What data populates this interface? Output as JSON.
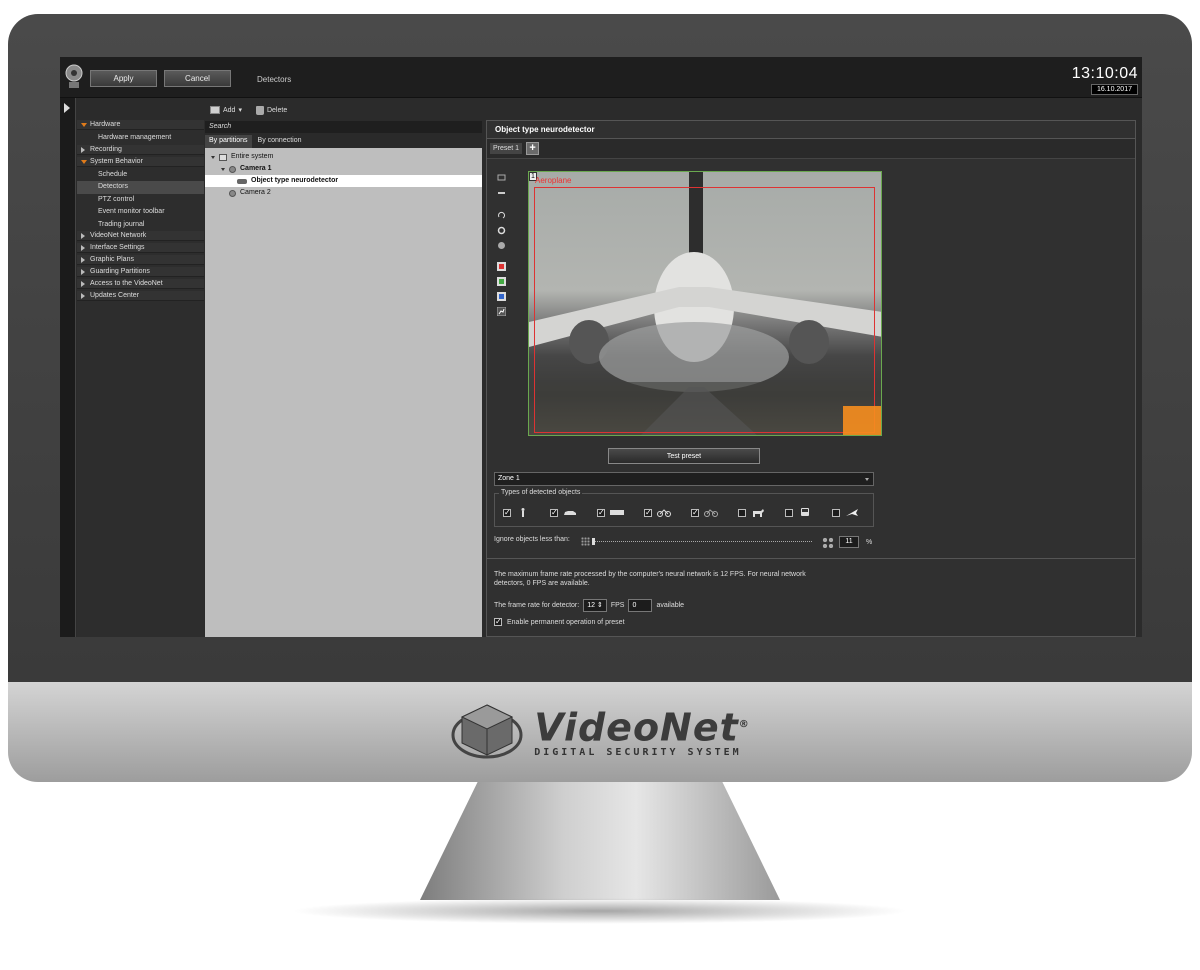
{
  "toolbar": {
    "apply_label": "Apply",
    "cancel_label": "Cancel",
    "breadcrumb": "Detectors"
  },
  "clock": {
    "time": "13:10:04",
    "date": "16.10.2017"
  },
  "nav": {
    "hardware": "Hardware",
    "hardware_management": "Hardware management",
    "recording": "Recording",
    "system_behavior": "System Behavior",
    "schedule": "Schedule",
    "detectors": "Detectors",
    "ptz_control": "PTZ control",
    "event_monitor_toolbar": "Event monitor toolbar",
    "trading_journal": "Trading journal",
    "videonet_network": "VideoNet Network",
    "interface_settings": "Interface Settings",
    "graphic_plans": "Graphic Plans",
    "guarding_partitions": "Guarding Partitions",
    "access_to_videonet": "Access to the VideoNet",
    "updates_center": "Updates Center"
  },
  "actions": {
    "add_label": "Add",
    "delete_label": "Delete"
  },
  "tree": {
    "search_placeholder": "Search",
    "tab_partitions": "By partitions",
    "tab_connection": "By connection",
    "entire_system": "Entire system",
    "camera1": "Camera 1",
    "detector": "Object type neurodetector",
    "camera2": "Camera 2"
  },
  "main": {
    "title": "Object type neurodetector",
    "preset_tab": "Preset 1",
    "preset_add": "+",
    "zone_number": "1",
    "zone_label": "Aeroplane",
    "test_preset_label": "Test preset",
    "zone_select_value": "Zone 1",
    "types_legend": "Types of detected objects",
    "types": [
      {
        "icon": "person-icon",
        "checked": true
      },
      {
        "icon": "car-icon",
        "checked": true
      },
      {
        "icon": "bus-icon",
        "checked": true
      },
      {
        "icon": "motorcycle-icon",
        "checked": true
      },
      {
        "icon": "bicycle-icon",
        "checked": true
      },
      {
        "icon": "dog-icon",
        "checked": false
      },
      {
        "icon": "train-icon",
        "checked": false
      },
      {
        "icon": "airplane-icon",
        "checked": false
      }
    ],
    "ignore_label": "Ignore objects less than:",
    "ignore_value": "11",
    "ignore_unit": "%",
    "info_text": "The maximum frame rate processed by the computer's neural network is 12 FPS. For neural network detectors, 0 FPS are available.",
    "fps_label": "The frame rate for detector:",
    "fps_value": "12",
    "fps_unit": "FPS",
    "fps_available_value": "0",
    "fps_available_label": "available",
    "permanent_label": "Enable permanent operation of preset"
  },
  "brand": {
    "name": "VideoNet",
    "tagline": "DIGITAL SECURITY SYSTEM",
    "reg": "®"
  }
}
